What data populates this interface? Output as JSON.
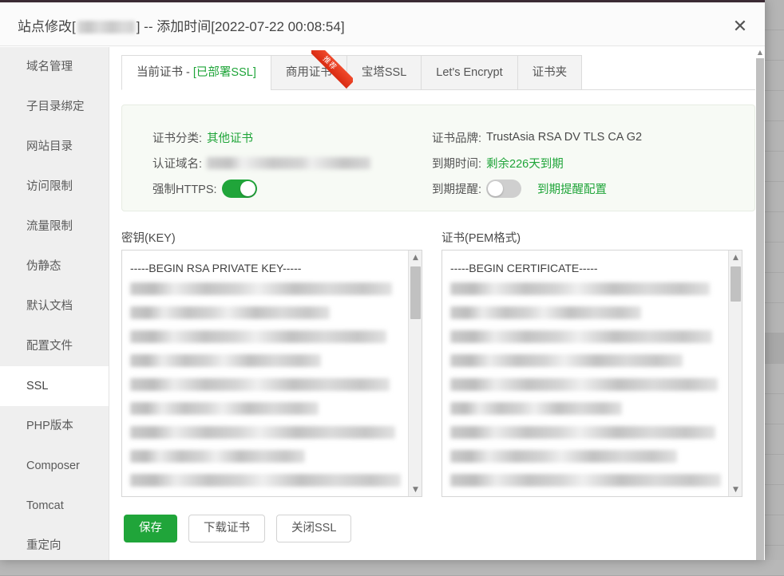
{
  "window": {
    "title_prefix": "站点修改[",
    "title_middle": "] -- 添加时间[",
    "title_time": "2022-07-22 00:08:54",
    "title_suffix": "]",
    "close_icon": "close-icon",
    "close_glyph": "✕"
  },
  "sidebar": {
    "items": [
      {
        "label": "域名管理",
        "active": false
      },
      {
        "label": "子目录绑定",
        "active": false
      },
      {
        "label": "网站目录",
        "active": false
      },
      {
        "label": "访问限制",
        "active": false
      },
      {
        "label": "流量限制",
        "active": false
      },
      {
        "label": "伪静态",
        "active": false
      },
      {
        "label": "默认文档",
        "active": false
      },
      {
        "label": "配置文件",
        "active": false
      },
      {
        "label": "SSL",
        "active": true
      },
      {
        "label": "PHP版本",
        "active": false
      },
      {
        "label": "Composer",
        "active": false
      },
      {
        "label": "Tomcat",
        "active": false
      },
      {
        "label": "重定向",
        "active": false
      }
    ]
  },
  "tabs": [
    {
      "label": "当前证书 - ",
      "highlight": "[已部署SSL]",
      "active": true,
      "ribbon": ""
    },
    {
      "label": "商用证书",
      "highlight": "",
      "active": false,
      "ribbon": "推荐"
    },
    {
      "label": "宝塔SSL",
      "highlight": "",
      "active": false,
      "ribbon": ""
    },
    {
      "label": "Let's Encrypt",
      "highlight": "",
      "active": false,
      "ribbon": ""
    },
    {
      "label": "证书夹",
      "highlight": "",
      "active": false,
      "ribbon": ""
    }
  ],
  "info": {
    "cert_type_label": "证书分类:",
    "cert_type_value": "其他证书",
    "domain_label": "认证域名:",
    "domain_value": "",
    "force_https_label": "强制HTTPS:",
    "force_https_on": true,
    "brand_label": "证书品牌:",
    "brand_value": "TrustAsia RSA DV TLS CA G2",
    "expire_label": "到期时间:",
    "expire_value": "剩余226天到期",
    "remind_label": "到期提醒:",
    "remind_on": false,
    "remind_link": "到期提醒配置"
  },
  "key_panel": {
    "label": "密钥(KEY)",
    "first_line": "-----BEGIN RSA PRIVATE KEY-----",
    "redacted_lines": 9
  },
  "cert_panel": {
    "label": "证书(PEM格式)",
    "first_line": "-----BEGIN CERTIFICATE-----",
    "redacted_lines": 9
  },
  "buttons": [
    {
      "label": "保存",
      "primary": true
    },
    {
      "label": "下载证书",
      "primary": false
    },
    {
      "label": "关闭SSL",
      "primary": false
    }
  ],
  "colors": {
    "accent_green": "#20a53a",
    "ribbon_red": "#ea3c23",
    "sidebar_bg": "#efefef",
    "panel_bg": "#f7faf5"
  }
}
